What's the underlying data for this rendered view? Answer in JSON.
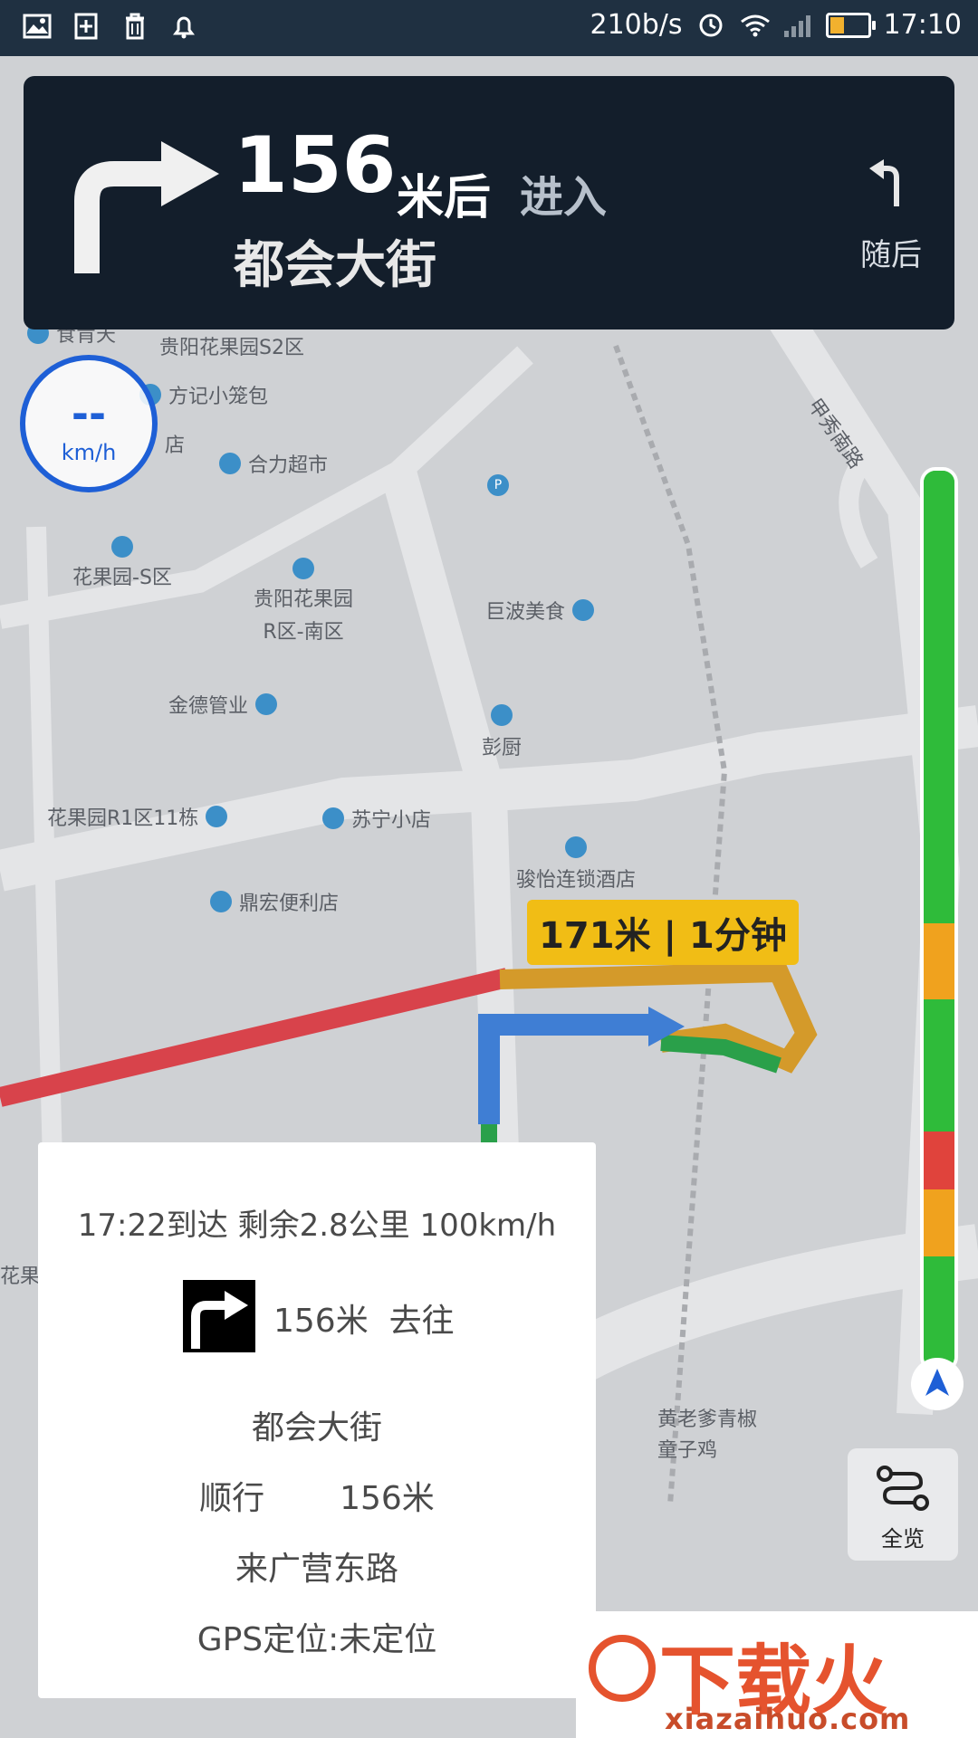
{
  "status_bar": {
    "net_speed": "210b/s",
    "time": "17:10",
    "battery_level": 0.35,
    "icons": [
      "gallery-icon",
      "add-note-icon",
      "trash-icon",
      "alarm-icon",
      "clock-icon",
      "wifi-icon",
      "signal-icon",
      "battery-icon"
    ]
  },
  "nav_card": {
    "distance": "156",
    "unit": "米后",
    "action": "进入",
    "street": "都会大街",
    "next_label": "随后",
    "turn_icon": "turn-right-icon",
    "next_icon": "turn-left-icon"
  },
  "speedometer": {
    "value": "--",
    "unit": "km/h"
  },
  "map": {
    "pois": [
      "食肯天",
      "贵阳花果园S2区",
      "方记小笼包",
      "店",
      "合力超市",
      "花果园-S区",
      "贵阳花果园",
      "R区-南区",
      "巨波美食",
      "金德管业",
      "彭厨",
      "花果园R1区11栋",
      "苏宁小店",
      "骏怡连锁酒店",
      "鼎宏便利店",
      "黄老爹青椒",
      "童子鸡",
      "甲秀南路",
      "花果"
    ],
    "route_tag": "171米 | 1分钟"
  },
  "traffic_bar": {
    "colors": {
      "green": "#2fbb3a",
      "orange": "#f0a21e",
      "red": "#e0433c"
    }
  },
  "overview_button": {
    "label": "全览",
    "icon": "route-overview-icon"
  },
  "info_dialog": {
    "summary": "17:22到达   剩余2.8公里   100km/h",
    "turn_distance": "156米",
    "turn_action": "去往",
    "target_street": "都会大街",
    "follow_label": "顺行",
    "follow_distance": "156米",
    "current_road": "来广营东路",
    "gps_status": "GPS定位:未定位"
  },
  "watermark": {
    "brand": "下载火",
    "url": "xiazaihuo.com"
  }
}
